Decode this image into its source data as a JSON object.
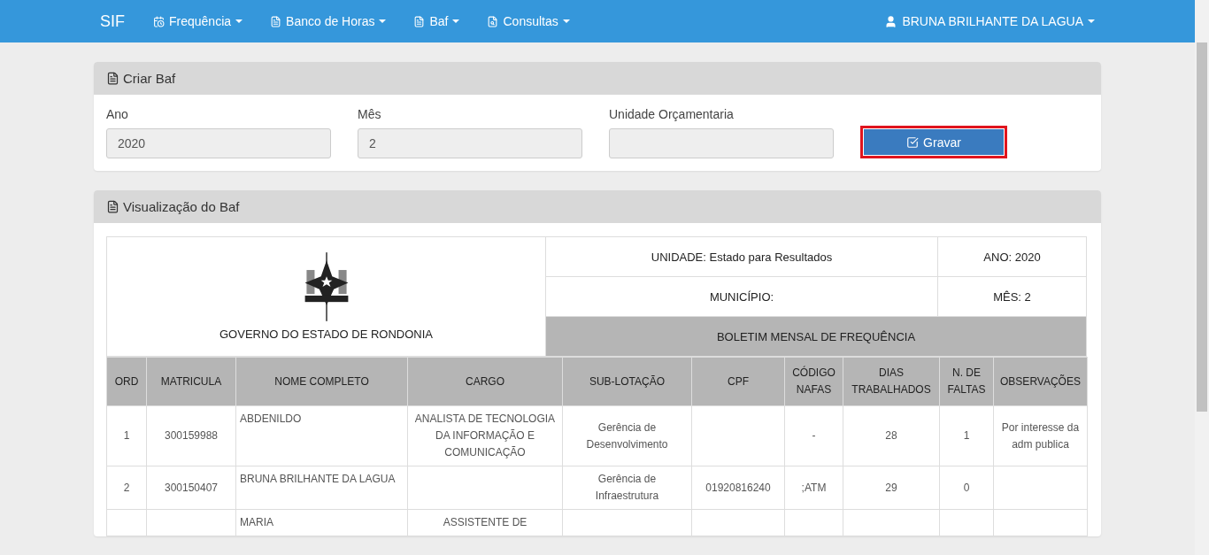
{
  "navbar": {
    "brand": "SIF",
    "menus": [
      {
        "label": "Frequência"
      },
      {
        "label": "Banco de Horas"
      },
      {
        "label": "Baf"
      },
      {
        "label": "Consultas"
      }
    ],
    "user": "BRUNA BRILHANTE DA LAGUA"
  },
  "create_panel": {
    "title": "Criar Baf",
    "fields": [
      {
        "label": "Ano",
        "value": "2020"
      },
      {
        "label": "Mês",
        "value": "2"
      },
      {
        "label": "Unidade Orçamentaria"
      }
    ],
    "button": "Gravar"
  },
  "view_panel": {
    "title": "Visualização do Baf",
    "header": {
      "government": "GOVERNO DO ESTADO DE RONDONIA",
      "unidade": "UNIDADE: Estado para Resultados",
      "ano": "ANO: 2020",
      "municipio": "MUNICÍPIO:",
      "mes": "MÊS: 2",
      "boletim": "BOLETIM MENSAL DE FREQUÊNCIA"
    },
    "columns": [
      "ORD",
      "MATRICULA",
      "NOME COMPLETO",
      "CARGO",
      "SUB-LOTAÇÃO",
      "CPF",
      "CÓDIGO NAFAS",
      "DIAS TRABALHADOS",
      "N. DE FALTAS",
      "OBSERVAÇÕES"
    ],
    "rows": [
      {
        "ord": "1",
        "matricula": "300159988",
        "nome": "ABDENILDO",
        "cargo": "ANALISTA DE TECNOLOGIA DA INFORMAÇÃO E COMUNICAÇÃO",
        "sub_lotacao": "Gerência de Desenvolvimento",
        "codigo": "-",
        "dias": "28",
        "faltas": "1",
        "observacoes": "Por interesse da adm publica"
      },
      {
        "ord": "2",
        "matricula": "300150407",
        "nome": "BRUNA BRILHANTE DA LAGUA",
        "sub_lotacao": "Gerência de Infraestrutura",
        "cpf": "01920816240",
        "codigo": ";ATM",
        "dias": "29",
        "faltas": "0"
      },
      {
        "nome": "MARIA",
        "cargo": "ASSISTENTE DE"
      }
    ]
  }
}
